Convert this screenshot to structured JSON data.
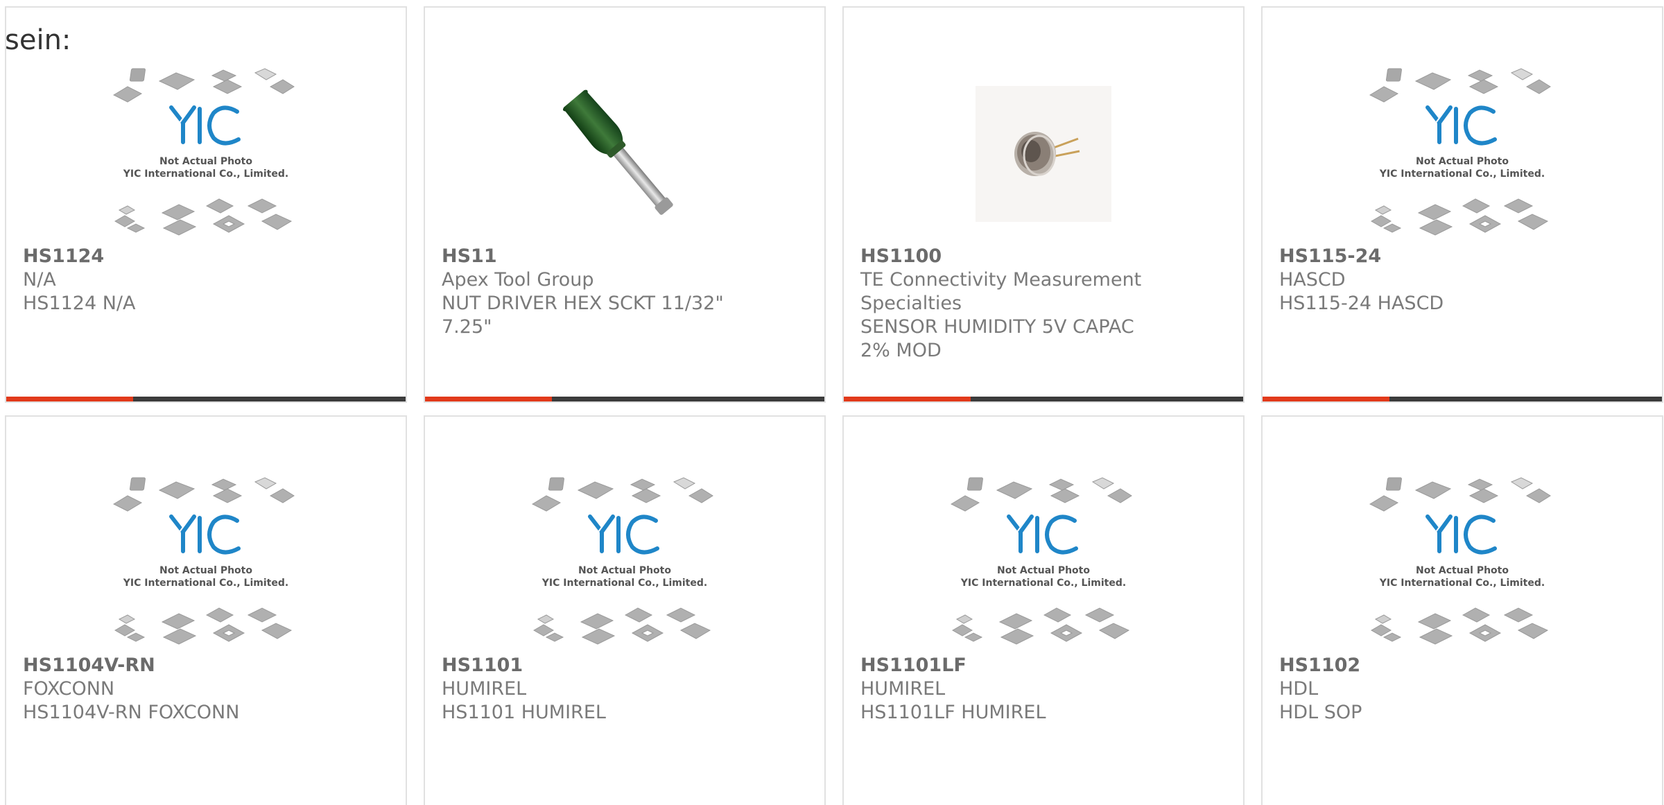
{
  "intro_text": "sein:",
  "placeholder": {
    "logo_text": "YIC",
    "line1": "Not Actual Photo",
    "line2": "YIC International Co., Limited."
  },
  "colors": {
    "accent": "#e23a1b",
    "bar_dark": "#3c3c3c",
    "logo_blue": "#1f86c8"
  },
  "products": [
    {
      "pn": "HS1124",
      "mfr": "N/A",
      "desc": "HS1124 N/A",
      "image": "placeholder-icon"
    },
    {
      "pn": "HS11",
      "mfr": "Apex Tool Group",
      "desc": "NUT DRIVER HEX SCKT 11/32\" 7.25\"",
      "image": "nut-driver-icon"
    },
    {
      "pn": "HS1100",
      "mfr": "TE Connectivity Measurement Specialties",
      "desc": "SENSOR HUMIDITY 5V CAPAC 2% MOD",
      "image": "humidity-sensor-icon"
    },
    {
      "pn": "HS115-24",
      "mfr": "HASCD",
      "desc": "HS115-24 HASCD",
      "image": "placeholder-icon"
    },
    {
      "pn": "HS1104V-RN",
      "mfr": "FOXCONN",
      "desc": "HS1104V-RN FOXCONN",
      "image": "placeholder-icon"
    },
    {
      "pn": "HS1101",
      "mfr": "HUMIREL",
      "desc": "HS1101 HUMIREL",
      "image": "placeholder-icon"
    },
    {
      "pn": "HS1101LF",
      "mfr": "HUMIREL",
      "desc": "HS1101LF HUMIREL",
      "image": "placeholder-icon"
    },
    {
      "pn": "HS1102",
      "mfr": "HDL",
      "desc": "HDL SOP",
      "image": "placeholder-icon"
    }
  ]
}
